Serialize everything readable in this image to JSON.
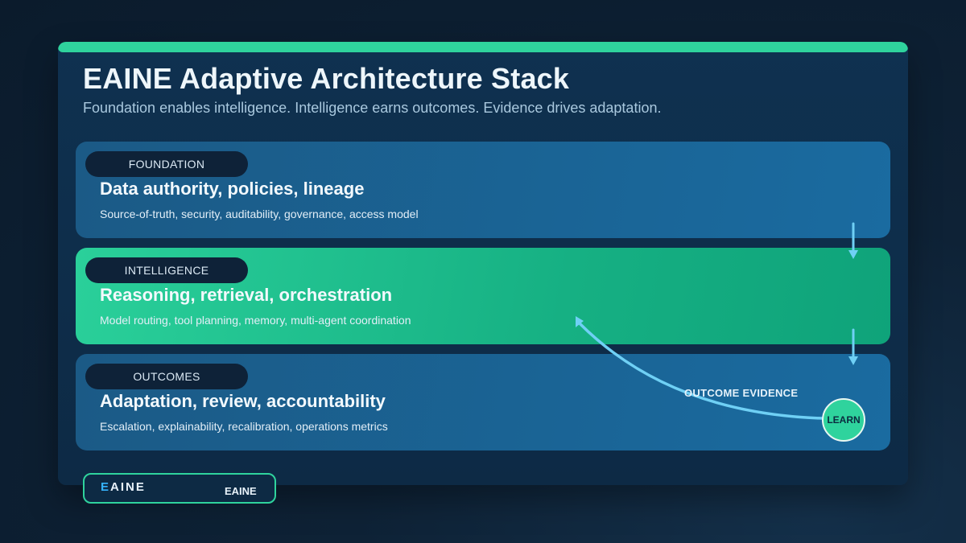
{
  "title": "EAINE Adaptive Architecture Stack",
  "subtitle": "Foundation enables intelligence. Intelligence earns outcomes. Evidence drives adaptation.",
  "layers": [
    {
      "label": "FOUNDATION",
      "heading": "Data authority, policies, lineage",
      "description": "Source-of-truth, security, auditability, governance, access model"
    },
    {
      "label": "INTELLIGENCE",
      "heading": "Reasoning, retrieval, orchestration",
      "description": "Model routing, tool planning, memory, multi-agent coordination"
    },
    {
      "label": "OUTCOMES",
      "heading": "Adaptation, review, accountability",
      "description": "Escalation, explainability, recalibration, operations metrics"
    }
  ],
  "feedback": {
    "label": "OUTCOME EVIDENCE",
    "badge": "LEARN"
  },
  "brand": {
    "logo_first": "E",
    "logo_rest": "AINE",
    "name": "EAINE"
  },
  "colors": {
    "accent": "#2fd39d",
    "arrow": "#6fd0f5",
    "background": "#0b1b2c"
  }
}
